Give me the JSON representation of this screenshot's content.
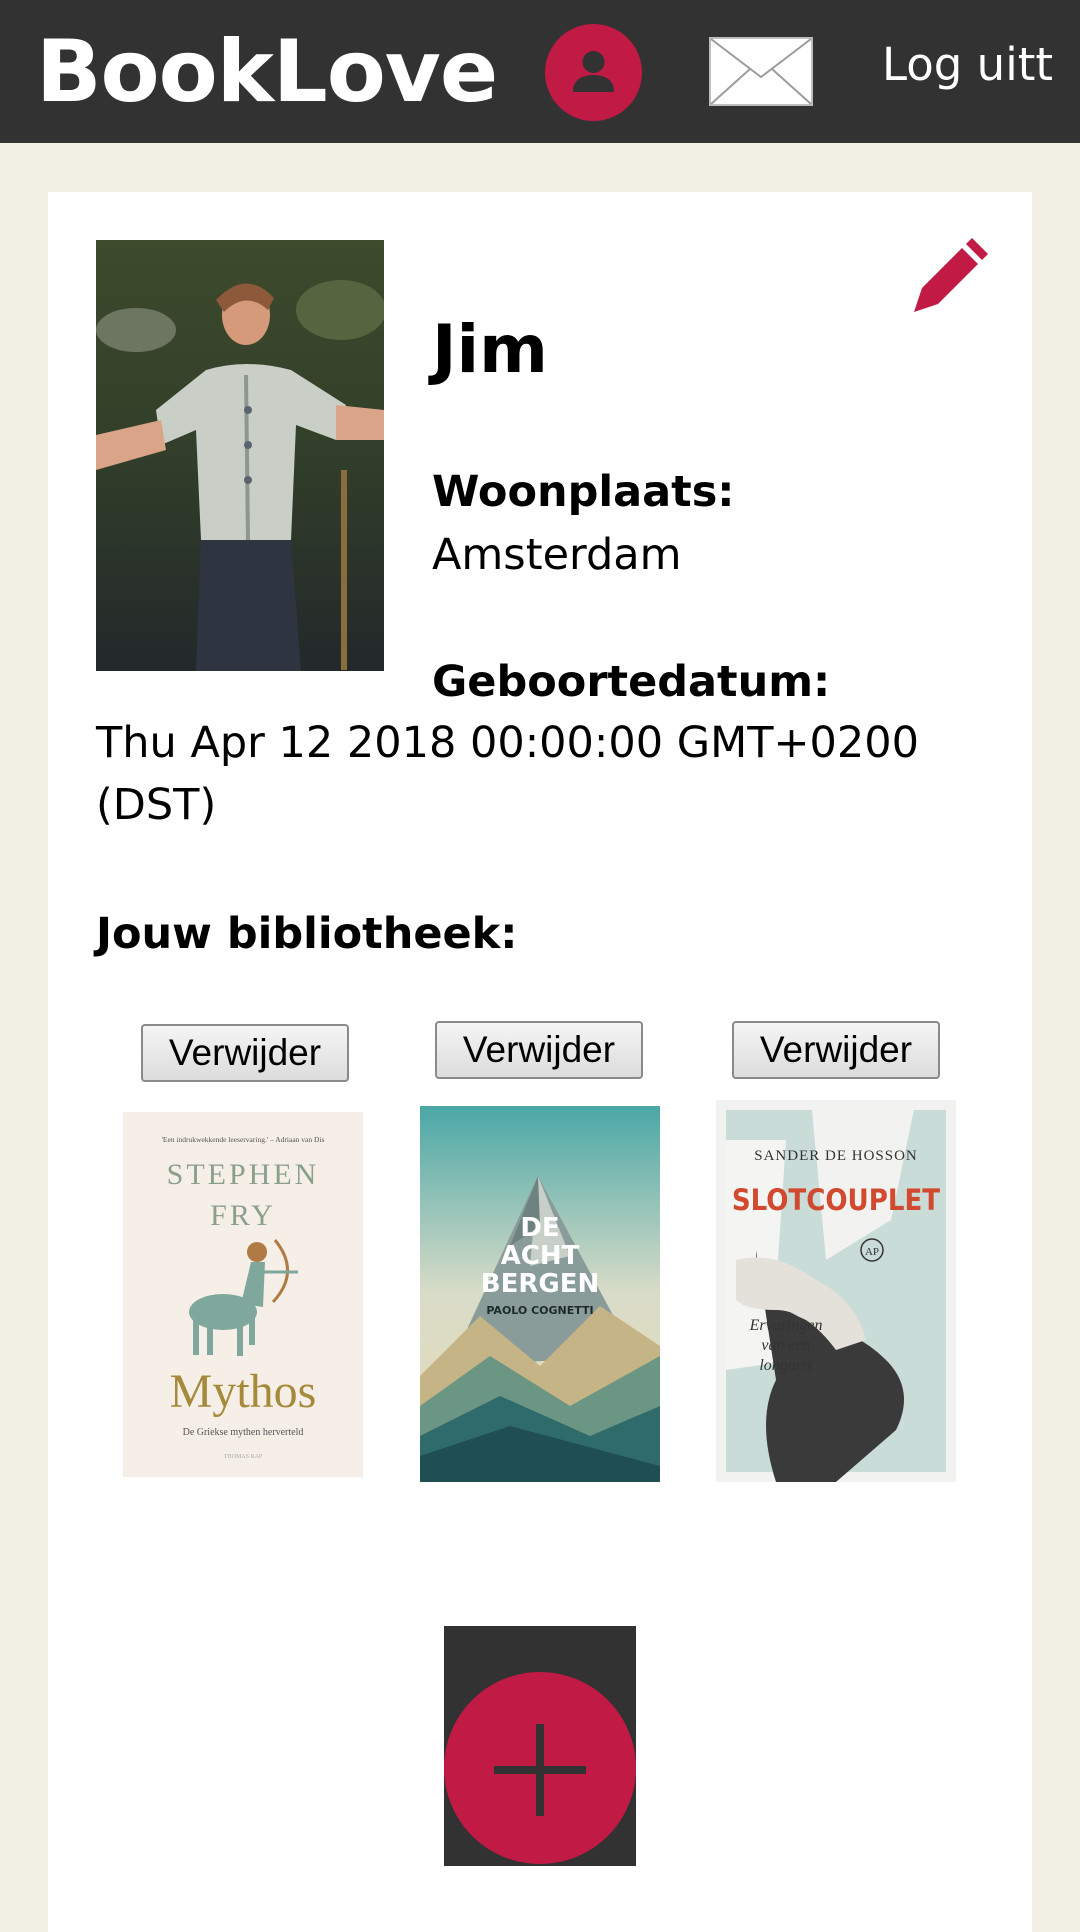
{
  "header": {
    "brand": "BookLove",
    "profile_icon": "user-icon",
    "mail_icon": "envelope-icon",
    "logout_label": "Log uitt"
  },
  "profile": {
    "name": "Jim",
    "residence_label": "Woonplaats:",
    "residence_value": "Amsterdam",
    "birthdate_label": "Geboortedatum:",
    "birthdate_value": "Thu Apr 12 2018 00:00:00 GMT+0200 (DST)",
    "edit_icon": "pencil-icon"
  },
  "library": {
    "title": "Jouw bibliotheek:",
    "remove_label": "Verwijder",
    "books": [
      {
        "quote": "'Een indrukwekkende leeservaring.' – Adriaan van Dis",
        "author": [
          "STEPHEN",
          "FRY"
        ],
        "title": "Mythos",
        "subtitle": "De Griekse mythen herverteld",
        "publisher": "THOMAS RAP"
      },
      {
        "title": [
          "DE",
          "ACHT",
          "BERGEN"
        ],
        "author": "PAOLO COGNETTI"
      },
      {
        "author": "SANDER DE HOSSON",
        "title": "SLOTCOUPLET",
        "subtitle": [
          "Ervaringen",
          "van een",
          "longarts"
        ],
        "publisher": "AP"
      }
    ]
  },
  "add_button": {
    "icon": "plus-icon"
  },
  "colors": {
    "accent": "#c01a45",
    "topbar": "#323232",
    "background": "#f3f1e5"
  }
}
